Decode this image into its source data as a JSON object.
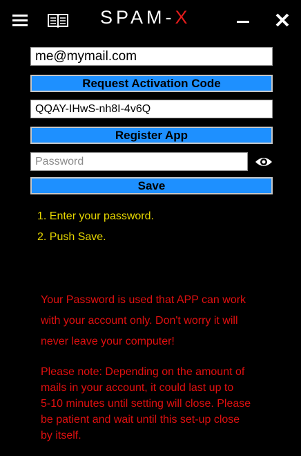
{
  "window": {
    "logo_main": "SPAM-",
    "logo_accent": "X",
    "menu_icon": "hamburger-icon",
    "book_icon": "book-icon",
    "minimize_icon": "minimize-icon",
    "close_icon": "close-icon"
  },
  "form": {
    "email_value": "me@mymail.com",
    "request_code_label": "Request Activation Code",
    "activation_code_value": "QQAY-IHwS-nh8I-4v6Q",
    "register_label": "Register App",
    "password_placeholder": "Password",
    "password_toggle_icon": "eye-icon",
    "save_label": "Save"
  },
  "instructions": [
    "1. Enter your password.",
    "2. Push Save."
  ],
  "notice_1": [
    "Your Password is used that APP can work",
    "with your account only. Don't worry it will",
    "never leave your computer!"
  ],
  "notice_2": [
    "Please note: Depending on the amount of",
    "mails in your account, it could last up to",
    "5-10 minutes until setting will close. Please",
    "be patient and wait until this set-up close",
    "by itself."
  ],
  "colors": {
    "background": "#000000",
    "button_fill": "#1e90ff",
    "instruction_text": "#e8d800",
    "notice_text": "#e01010",
    "logo_accent": "#e21b1b"
  }
}
